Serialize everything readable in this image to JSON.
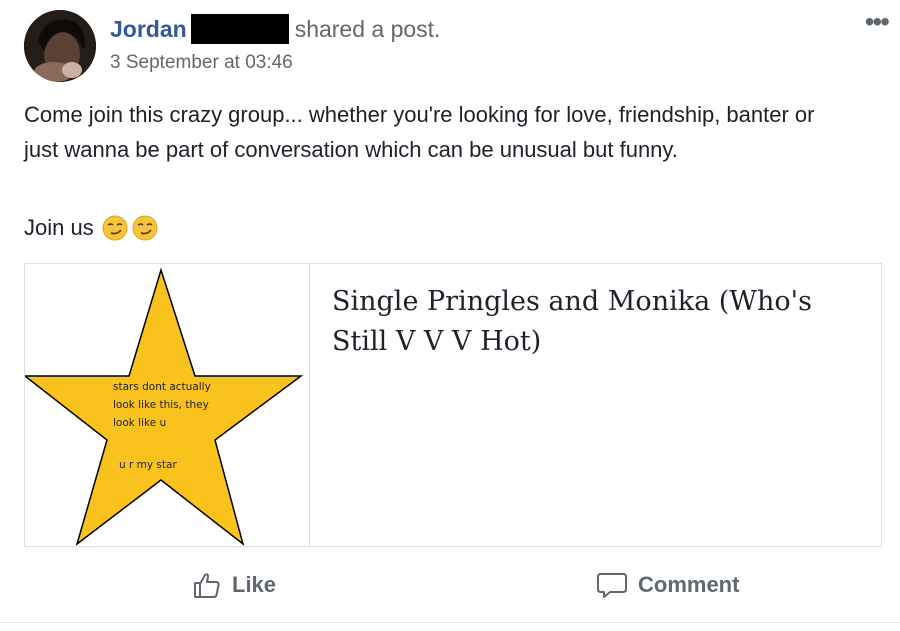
{
  "post": {
    "author": "Jordan",
    "action_text": "shared a post.",
    "timestamp": "3 September at 03:46",
    "more_label": "•••",
    "body": "Come join this crazy group... whether you're looking for love, friendship, banter or just wanna be part of conversation which can be unusual but funny.",
    "join_text": "Join us",
    "emojis": [
      "smirk-emoji",
      "smirk-emoji"
    ]
  },
  "link_card": {
    "title": "Single Pringles and Monika (Who's Still V V V Hot)",
    "image_text": {
      "line1": "stars dont actually",
      "line2": "look like this, they",
      "line3": "look like u",
      "line4": "u r my star"
    },
    "star_color": "#f9c21d"
  },
  "actions": {
    "like_label": "Like",
    "comment_label": "Comment"
  },
  "colors": {
    "author_link": "#365899",
    "secondary_text": "#616770",
    "border": "#dddfe2"
  }
}
